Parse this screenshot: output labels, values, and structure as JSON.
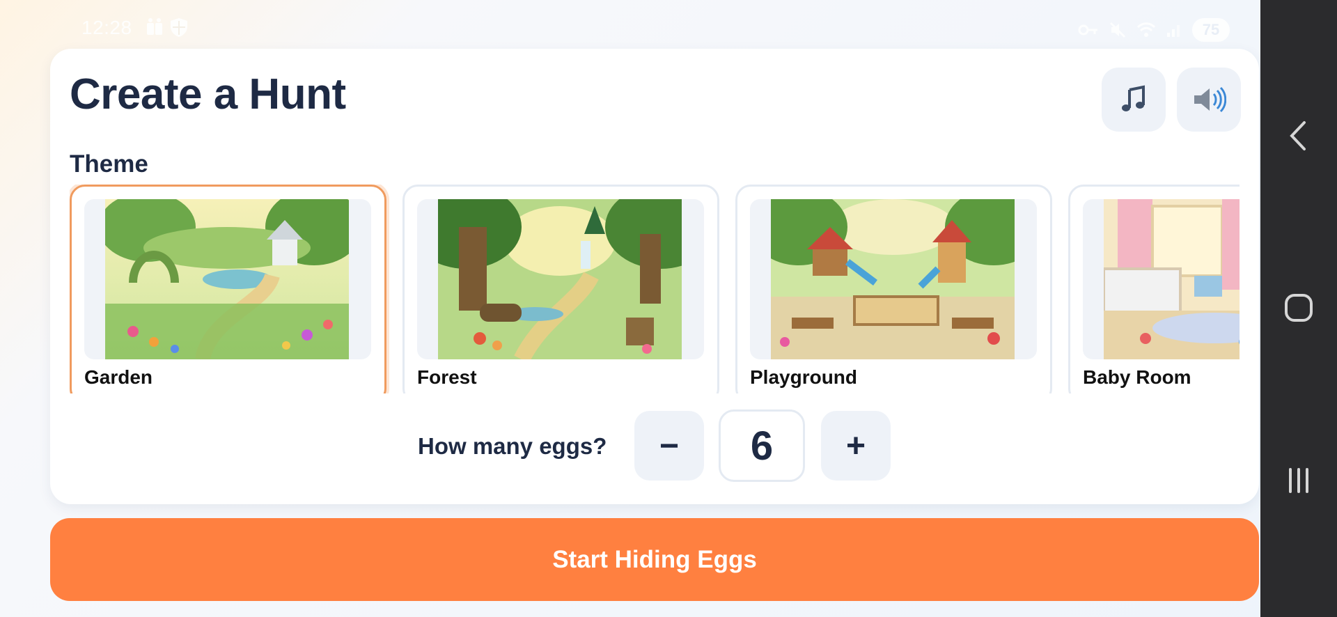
{
  "status_bar": {
    "time": "12:28",
    "battery": "75",
    "left_icons": [
      "media-icon",
      "shield-icon"
    ],
    "right_icons": [
      "key-icon",
      "mute-icon",
      "wifi-icon",
      "signal-icon"
    ]
  },
  "header": {
    "title": "Create a Hunt",
    "music_icon": "music-note-icon",
    "sound_icon": "speaker-icon"
  },
  "theme_section": {
    "label": "Theme",
    "selected": "Garden",
    "themes": [
      {
        "label": "Garden"
      },
      {
        "label": "Forest"
      },
      {
        "label": "Playground"
      },
      {
        "label": "Baby Room"
      }
    ]
  },
  "eggs": {
    "label": "How many eggs?",
    "minus": "−",
    "plus": "+",
    "count": "6"
  },
  "start_button": {
    "label": "Start Hiding Eggs"
  },
  "colors": {
    "accent": "#ff8040",
    "selected_border": "#f09b5e",
    "title_text": "#1e2a44",
    "button_bg": "#eef2f8",
    "nav_bar": "#2b2b2d"
  },
  "nav_bar": {
    "icons": [
      "back-icon",
      "home-icon",
      "recents-icon"
    ]
  }
}
